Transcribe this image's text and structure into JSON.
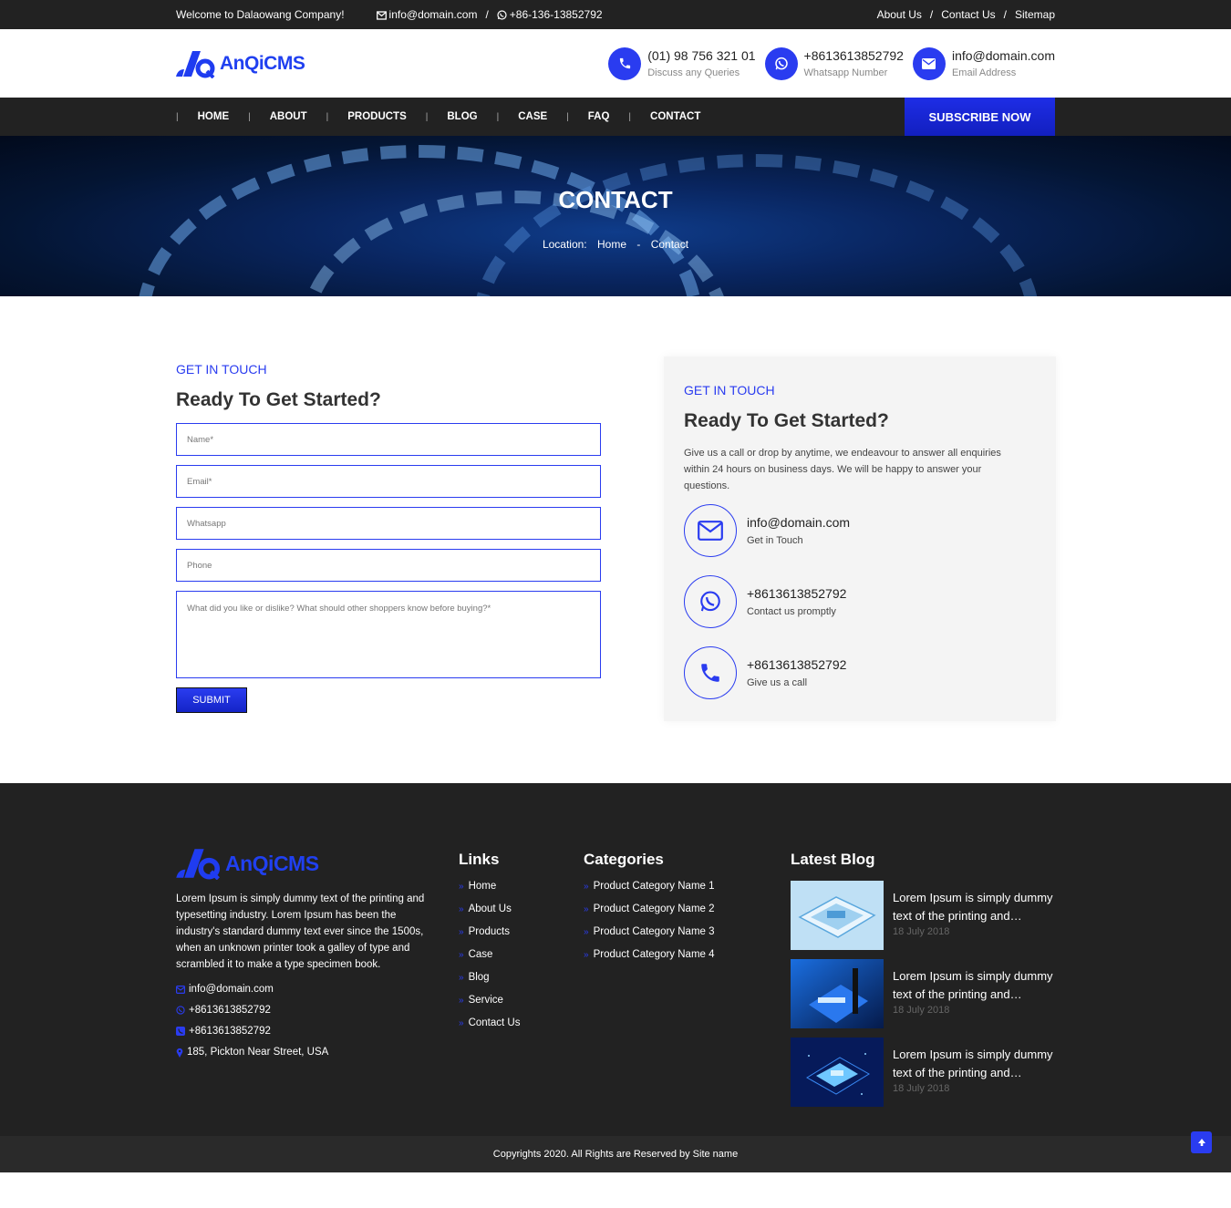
{
  "topbar": {
    "welcome": "Welcome to Dalaowang Company!",
    "email": "info@domain.com",
    "sep": "/",
    "phone": "+86-136-13852792",
    "links": [
      "About Us",
      "Contact Us",
      "Sitemap"
    ]
  },
  "header": {
    "logo_text": "AnQiCMS",
    "items": [
      {
        "main": "(01) 98 756 321 01",
        "sub": "Discuss any Queries",
        "icon": "phone-icon"
      },
      {
        "main": "+8613613852792",
        "sub": "Whatsapp Number",
        "icon": "whatsapp-icon"
      },
      {
        "main": "info@domain.com",
        "sub": "Email Address",
        "icon": "envelope-icon"
      }
    ]
  },
  "nav": {
    "items": [
      "HOME",
      "ABOUT",
      "PRODUCTS",
      "BLOG",
      "CASE",
      "FAQ",
      "CONTACT"
    ],
    "subscribe": "SUBSCRIBE NOW"
  },
  "banner": {
    "title": "CONTACT",
    "location_label": "Location:",
    "home": "Home",
    "dash": "-",
    "current": "Contact"
  },
  "form": {
    "eyebrow": "GET IN TOUCH",
    "title": "Ready To Get Started?",
    "placeholders": {
      "name": "Name*",
      "email": "Email*",
      "whatsapp": "Whatsapp",
      "phone": "Phone",
      "message": "What did you like or dislike? What should other shoppers know before buying?*"
    },
    "submit": "SUBMIT"
  },
  "card": {
    "eyebrow": "GET IN TOUCH",
    "title": "Ready To Get Started?",
    "text": "Give us a call or drop by anytime, we endeavour to answer all enquiries within 24 hours on business days. We will be happy to answer your questions.",
    "items": [
      {
        "main": "info@domain.com",
        "sub": "Get in Touch",
        "icon": "envelope-icon"
      },
      {
        "main": "+8613613852792",
        "sub": "Contact us promptly",
        "icon": "whatsapp-icon"
      },
      {
        "main": "+8613613852792",
        "sub": "Give us a call",
        "icon": "phone-icon"
      }
    ]
  },
  "footer": {
    "logo_text": "AnQiCMS",
    "desc": "Lorem Ipsum is simply dummy text of the printing and typesetting industry. Lorem Ipsum has been the industry's standard dummy text ever since the 1500s, when an unknown printer took a galley of type and scrambled it to make a type specimen book.",
    "contacts": [
      "info@domain.com",
      "+8613613852792",
      "+8613613852792",
      "185, Pickton Near Street, USA"
    ],
    "links_title": "Links",
    "links": [
      "Home",
      "About Us",
      "Products",
      "Case",
      "Blog",
      "Service",
      "Contact Us"
    ],
    "categories_title": "Categories",
    "categories": [
      "Product Category Name 1",
      "Product Category Name 2",
      "Product Category Name 3",
      "Product Category Name 4"
    ],
    "blog_title": "Latest Blog",
    "blogs": [
      {
        "title": "Lorem Ipsum is simply dummy text of the printing and…",
        "date": "18 July 2018"
      },
      {
        "title": "Lorem Ipsum is simply dummy text of the printing and…",
        "date": "18 July 2018"
      },
      {
        "title": "Lorem Ipsum is simply dummy text of the printing and…",
        "date": "18 July 2018"
      }
    ],
    "copyright": "Copyrights 2020. All Rights are Reserved by Site name"
  },
  "colors": {
    "accent": "#2a3cf0",
    "dark": "#222222",
    "banner": "#09255f"
  }
}
